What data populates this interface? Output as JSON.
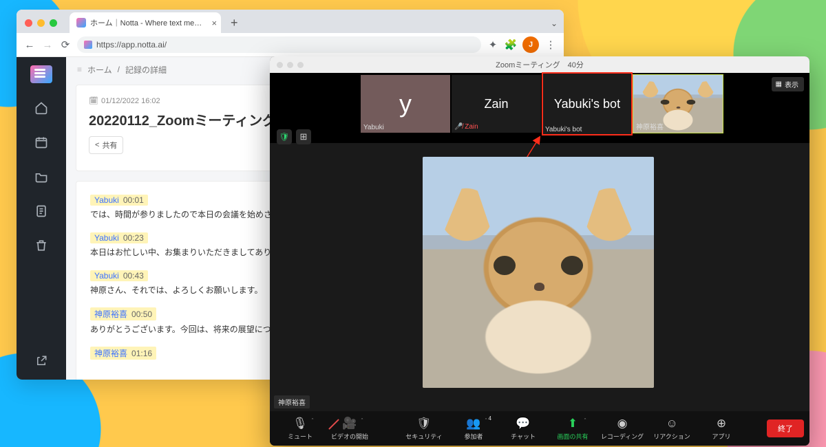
{
  "browser": {
    "tab_title": "ホーム｜Notta - Where text me…",
    "url": "https://app.notta.ai/",
    "avatar_initial": "J"
  },
  "notta": {
    "breadcrumb": {
      "home": "ホーム",
      "sep": "/",
      "detail": "記録の詳細"
    },
    "datetime": "01/12/2022 16:02",
    "title": "20220112_Zoomミーティング",
    "share_label": "共有",
    "transcript": [
      {
        "speaker": "Yabuki",
        "ts": "00:01",
        "text": "では、時間が参りましたので本日の会議を始めさせていただきます"
      },
      {
        "speaker": "Yabuki",
        "ts": "00:23",
        "text": "本日はお忙しい中、お集まりいただきましてありとうございます"
      },
      {
        "speaker": "Yabuki",
        "ts": "00:43",
        "text": "神原さん、それでは、よろしくお願いします。"
      },
      {
        "speaker": "神原裕喜",
        "ts": "00:50",
        "text": "ありがとうございます。今回は、将来の展望について尋ねられる"
      },
      {
        "speaker": "神原裕喜",
        "ts": "01:16",
        "text": ""
      }
    ]
  },
  "zoom": {
    "title": "Zoomミーティング　40分",
    "view_label": "表示",
    "tiles": [
      {
        "kind": "initial",
        "big": "y",
        "label": "Yabuki"
      },
      {
        "kind": "name",
        "big": "Zain",
        "label": "Zain",
        "muted": true
      },
      {
        "kind": "name",
        "big": "Yabuki's bot",
        "label": "Yabuki's bot",
        "highlight": true
      },
      {
        "kind": "video",
        "label": "神原裕喜",
        "active": true
      }
    ],
    "active_speaker": "神原裕喜",
    "toolbar": {
      "mute": "ミュート",
      "video": "ビデオの開始",
      "security": "セキュリティ",
      "participants": "参加者",
      "participants_count": "4",
      "chat": "チャット",
      "share": "画面の共有",
      "record": "レコーディング",
      "reactions": "リアクション",
      "apps": "アプリ",
      "end": "終了"
    }
  }
}
